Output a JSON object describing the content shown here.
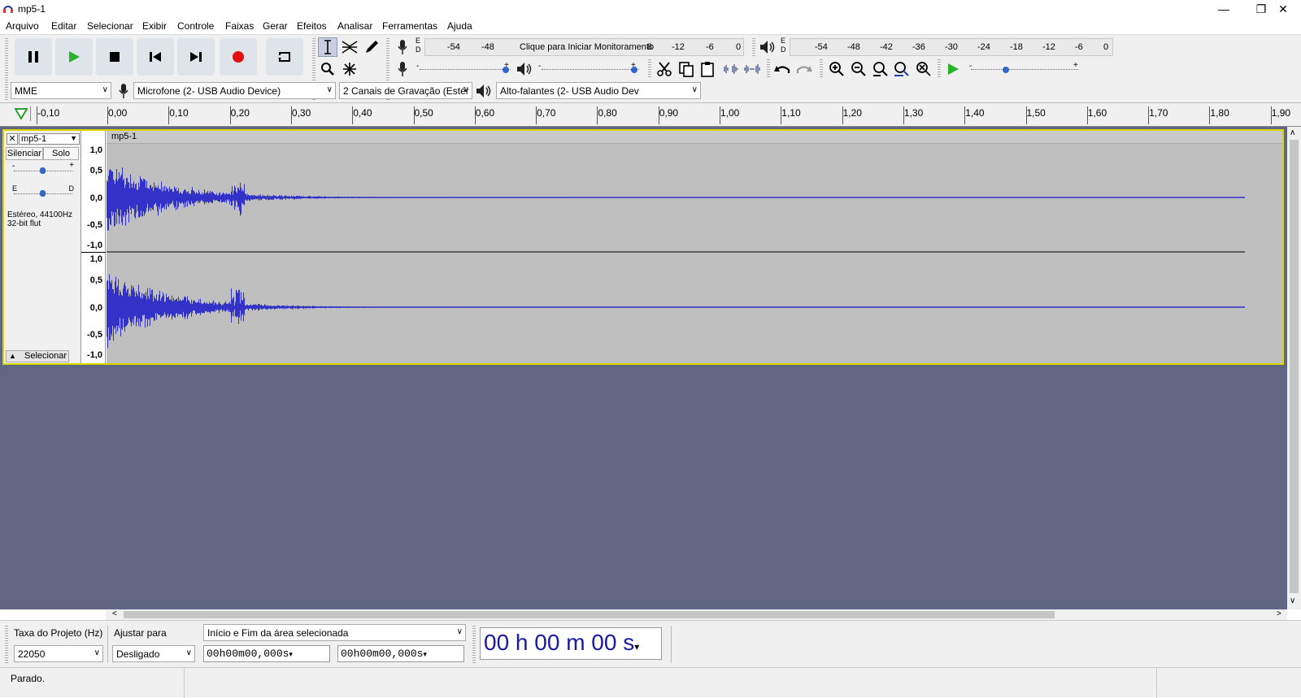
{
  "window": {
    "title": "mp5-1",
    "minimize": "—",
    "restore": "❐",
    "close": "✕"
  },
  "menu": [
    "Arquivo",
    "Editar",
    "Selecionar",
    "Exibir",
    "Controle",
    "Faixas",
    "Gerar",
    "Efeitos",
    "Analisar",
    "Ferramentas",
    "Ajuda"
  ],
  "meters": {
    "record_ticks": [
      "-54",
      "-48",
      "Clique para Iniciar Monitoramento",
      "8",
      "-12",
      "-6",
      "0"
    ],
    "play_ticks": [
      "-54",
      "-48",
      "-42",
      "-36",
      "-30",
      "-24",
      "-18",
      "-12",
      "-6",
      "0"
    ],
    "record_lr": [
      "E",
      "D"
    ],
    "play_lr": [
      "E",
      "D"
    ]
  },
  "devices": {
    "host": "MME",
    "input": "Microfone (2- USB Audio Device)",
    "channels": "2 Canais de  Gravação (Estér",
    "output": "Alto-falantes (2- USB Audio Dev"
  },
  "ruler_ticks": [
    "-0,10",
    "0,00",
    "0,10",
    "0,20",
    "0,30",
    "0,40",
    "0,50",
    "0,60",
    "0,70",
    "0,80",
    "0,90",
    "1,00",
    "1,10",
    "1,20",
    "1,30",
    "1,40",
    "1,50",
    "1,60",
    "1,70",
    "1,80",
    "1,90"
  ],
  "track": {
    "name": "mp5-1",
    "clip_name": "mp5-1",
    "mute": "Silenciar",
    "solo": "Solo",
    "pan_left": "E",
    "pan_right": "D",
    "info1": "Estéreo, 44100Hz",
    "info2": "32-bit flut",
    "select": "Selecionar",
    "scale": [
      "1,0",
      "0,5",
      "0,0",
      "-0,5",
      "-1,0"
    ]
  },
  "selection_bar": {
    "rate_label": "Taxa do Projeto (Hz)",
    "rate_value": "22050",
    "snap_label": "Ajustar para",
    "snap_value": "Desligado",
    "range_label": "Início e Fim da área selecionada",
    "start_time": "00h00m00,000s",
    "end_time": "00h00m00,000s",
    "big_time": "00 h 00 m 00 s"
  },
  "status": "Parado.",
  "colors": {
    "wave": "#3232c8",
    "track_bg": "#bfbfbf",
    "area_bg": "#616683",
    "selection_border": "#d8d800",
    "record": "#e01010",
    "play": "#28b428"
  }
}
